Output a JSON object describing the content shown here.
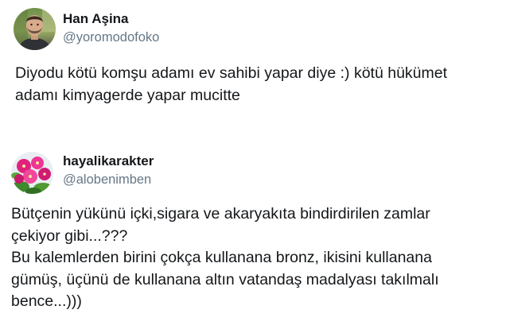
{
  "tweets": [
    {
      "author": {
        "name": "Han Aşina",
        "handle": "@yoromodofoko"
      },
      "text": "Diyodu kötü komşu adamı ev sahibi yapar diye :) kötü hükümet\nadamı kimyagerde yapar mucitte"
    },
    {
      "author": {
        "name": "hayalikarakter",
        "handle": "@alobenimben"
      },
      "text": "Bütçenin yükünü içki,sigara ve akaryakıta bindirdirilen zamlar\nçekiyor gibi...???\nBu kalemlerden birini çokça kullanana bronz, ikisini kullanana\ngümüş, üçünü de kullanana altın vatandaş madalyası takılmalı\nbence...)))"
    }
  ]
}
